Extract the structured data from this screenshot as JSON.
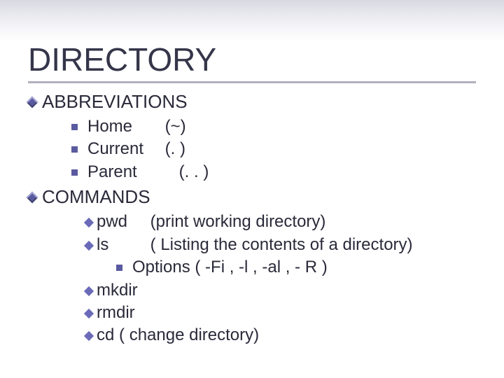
{
  "title": "DIRECTORY",
  "sections": {
    "abbrev": {
      "label": "ABBREVIATIONS",
      "items": [
        {
          "name": "Home",
          "sym": "(~)"
        },
        {
          "name": "Current",
          "sym": "(. )"
        },
        {
          "name": "Parent",
          "sym": "(. . )"
        }
      ]
    },
    "commands": {
      "label": "COMMANDS",
      "items": [
        {
          "cmd": "pwd",
          "desc": "(print working directory)"
        },
        {
          "cmd": "ls",
          "desc": "( Listing the contents of a directory)",
          "options_label": "Options",
          "options": "(   -Fi  ,   -l  ,   -al  ,  - R )"
        },
        {
          "cmd": "mkdir",
          "desc": ""
        },
        {
          "cmd": "rmdir",
          "desc": ""
        },
        {
          "cmd": "cd",
          "desc": "( change directory)"
        }
      ]
    }
  }
}
